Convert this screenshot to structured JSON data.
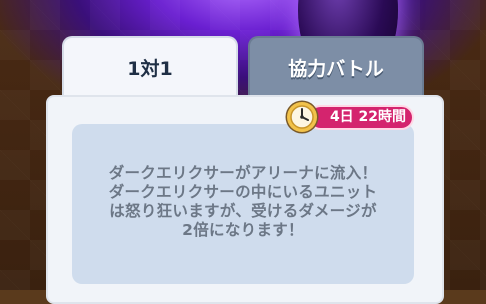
{
  "tabs": [
    {
      "label": "1対1"
    },
    {
      "label": "協力バトル"
    }
  ],
  "timer": {
    "label": "4日 22時間",
    "icon": "clock-icon"
  },
  "event": {
    "lines": [
      "ダークエリクサーがアリーナに流入！",
      "ダークエリクサーの中にいるユニット",
      "は怒り狂いますが、受けるダメージが",
      "2倍になります！"
    ]
  },
  "colors": {
    "timer_pill": "#d4246e",
    "active_tab": "#f4f6fb",
    "inactive_tab": "#7d8ea6",
    "text_box": "#cfdced"
  }
}
